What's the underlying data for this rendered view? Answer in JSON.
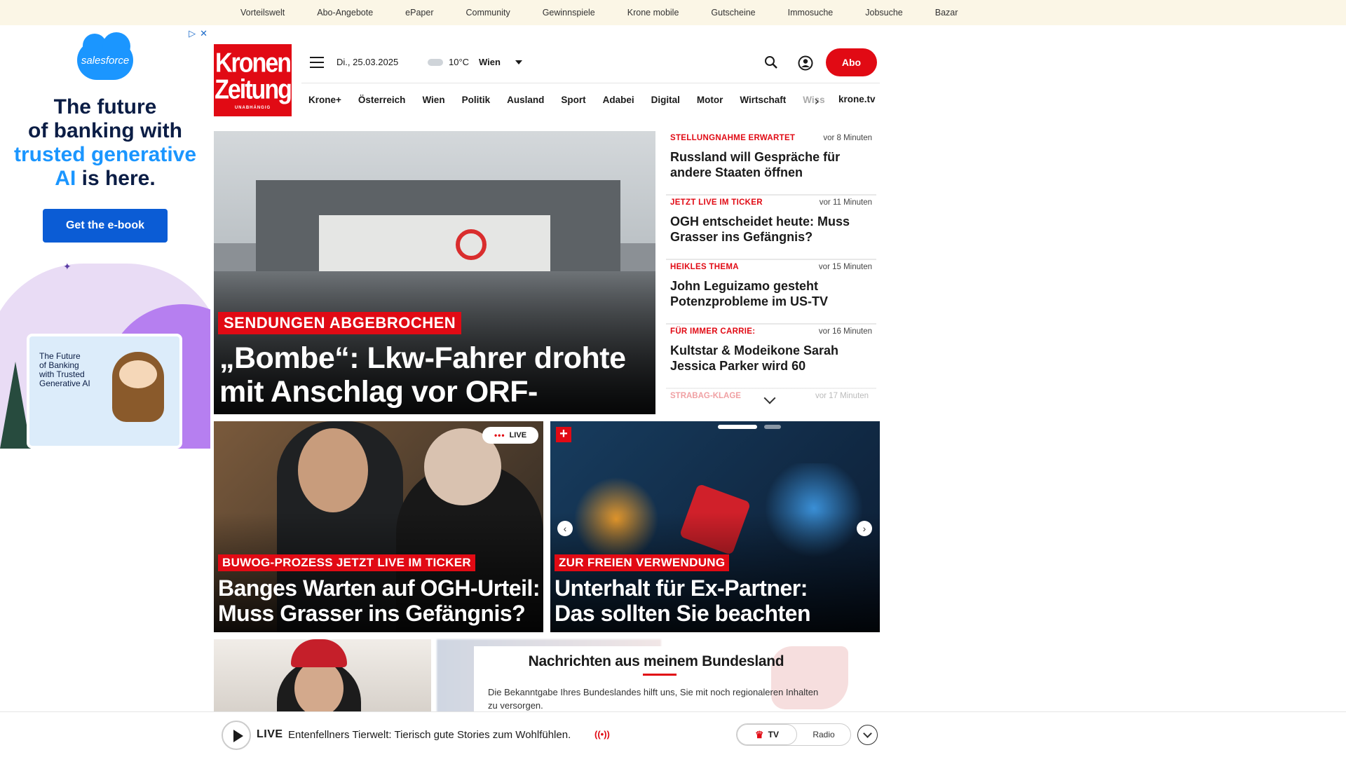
{
  "topbar": {
    "links": [
      "Vorteilswelt",
      "Abo-Angebote",
      "ePaper",
      "Community",
      "Gewinnspiele",
      "Krone mobile",
      "Gutscheine",
      "Immosuche",
      "Jobsuche",
      "Bazar"
    ]
  },
  "ad": {
    "brand": "salesforce",
    "headline_1": "The future",
    "headline_2": "of banking with",
    "headline_3": "trusted generative",
    "headline_4a": "AI",
    "headline_4b": " is here.",
    "cta": "Get the e-book",
    "card_text_1": "The Future",
    "card_text_2": "of Banking",
    "card_text_3": "with Trusted",
    "card_text_4": "Generative AI"
  },
  "header": {
    "logo_line1": "Kronen",
    "logo_line2": "Zeitung",
    "logo_line3": "UNABHÄNGIG",
    "date": "Di., 25.03.2025",
    "temperature": "10°C",
    "city": "Wien",
    "abo_label": "Abo"
  },
  "nav": {
    "items": [
      "Krone+",
      "Österreich",
      "Wien",
      "Politik",
      "Ausland",
      "Sport",
      "Adabei",
      "Digital",
      "Motor",
      "Wirtschaft"
    ],
    "faded_item": "Wiss",
    "tv_label": "krone.tv"
  },
  "hero": {
    "tag": "SENDUNGEN ABGEBROCHEN",
    "title": "„Bombe“: Lkw-Fahrer drohte mit Anschlag vor ORF-Zentrum"
  },
  "news": [
    {
      "kicker": "STELLUNGNAHME ERWARTET",
      "time": "vor 8 Minuten",
      "title": "Russland will Gespräche für andere Staaten öffnen"
    },
    {
      "kicker": "JETZT LIVE IM TICKER",
      "time": "vor 11 Minuten",
      "title": "OGH entscheidet heute: Muss Grasser ins Gefängnis?"
    },
    {
      "kicker": "HEIKLES THEMA",
      "time": "vor 15 Minuten",
      "title": "John Leguizamo gesteht Potenzprobleme im US-TV"
    },
    {
      "kicker": "FÜR IMMER CARRIE:",
      "time": "vor 16 Minuten",
      "title": "Kultstar & Modeikone Sarah Jessica Parker wird 60"
    }
  ],
  "news_more": {
    "kicker": "STRABAG-KLAGE",
    "time": "vor 17 Minuten"
  },
  "cards": [
    {
      "tag": "BUWOG-PROZESS JETZT LIVE IM TICKER",
      "title_1": "Banges Warten auf OGH-Urteil:",
      "title_2": "Muss Grasser ins Gefängnis?",
      "badge": "LIVE"
    },
    {
      "tag": "ZUR FREIEN VERWENDUNG",
      "title_1": "Unterhalt für Ex-Partner:",
      "title_2": "Das sollten Sie beachten",
      "badge": "+"
    }
  ],
  "bundesland": {
    "title": "Nachrichten aus meinem Bundesland",
    "text": "Die Bekanntgabe Ihres Bundeslandes hilft uns, Sie mit noch regionaleren Inhalten zu versorgen."
  },
  "livebar": {
    "label": "LIVE",
    "text": "Entenfellners Tierwelt: Tierisch gute Stories zum Wohlfühlen.",
    "tv": "TV",
    "radio": "Radio"
  },
  "colors": {
    "brand_red": "#e10a14",
    "topbar_bg": "#fbf6e6",
    "ad_blue": "#0b5cd5"
  }
}
